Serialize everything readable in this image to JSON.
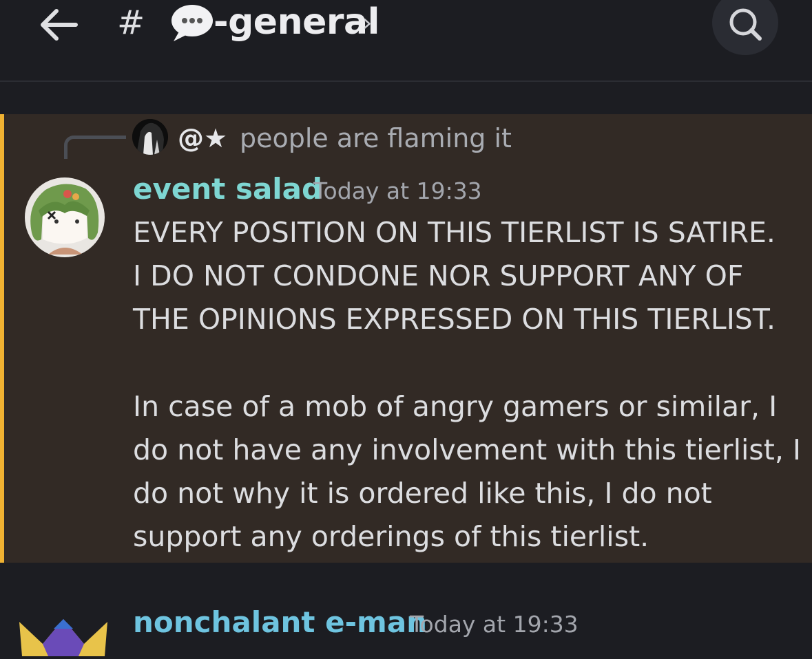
{
  "header": {
    "back_icon": "arrow-left-icon",
    "hash": "#",
    "channel_emoji": "speech-bubble-icon",
    "channel_name": "-general",
    "chevron": "›",
    "search_icon": "search-icon"
  },
  "message": {
    "accent_color": "#f0b232",
    "reply": {
      "user": "@★",
      "text": "people are flaming it"
    },
    "username": "event salad",
    "username_color": "#7ed6d2",
    "timestamp": "Today at 19:33",
    "lines": [
      "EVERY POSITION ON THIS TIERLIST IS SATIRE.",
      "I DO NOT CONDONE NOR SUPPORT ANY OF",
      "THE OPINIONS EXPRESSED ON THIS TIERLIST.",
      "In case of a mob of angry gamers or similar, I",
      "do not have any involvement with this tierlist, I",
      "do not why it is ordered like this, I do not",
      "support any orderings of this tierlist."
    ]
  },
  "next_message": {
    "username": "nonchalant e-man",
    "timestamp": "Today at 19:33"
  }
}
